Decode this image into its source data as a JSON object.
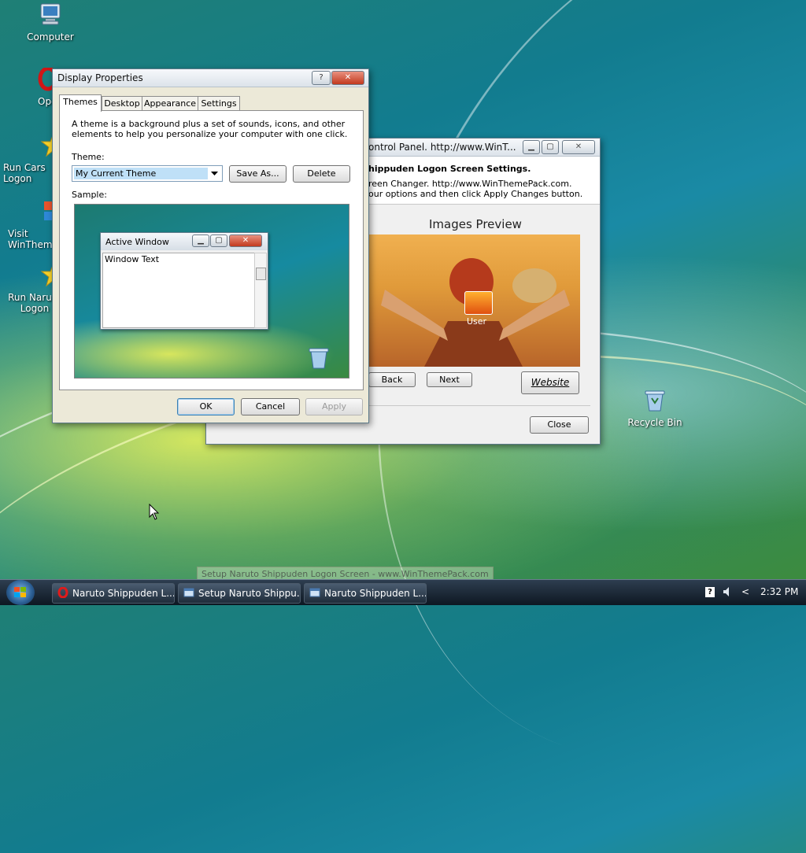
{
  "desktop": {
    "icons": [
      {
        "label": "Computer"
      },
      {
        "label": "Opera"
      },
      {
        "label": "Run Cars Logon"
      },
      {
        "label": "Visit WinThemePack"
      },
      {
        "label": "Run Naruto Logon"
      },
      {
        "label": "Recycle Bin"
      }
    ]
  },
  "display_props": {
    "title": "Display Properties",
    "help_glyph": "?",
    "close_glyph": "✕",
    "tabs": [
      {
        "label": "Themes"
      },
      {
        "label": "Desktop"
      },
      {
        "label": "Appearance"
      },
      {
        "label": "Settings"
      }
    ],
    "description": "A theme is a background plus a set of sounds, icons, and other elements to help you personalize your computer with one click.",
    "theme_label": "Theme:",
    "theme_value": "My Current Theme",
    "save_as": "Save As...",
    "delete": "Delete",
    "sample_label": "Sample:",
    "sample_window_title": "Active Window",
    "sample_window_text": "Window Text",
    "ok": "OK",
    "cancel": "Cancel",
    "apply": "Apply"
  },
  "logon_window": {
    "title": "ontrol Panel. http://www.WinT...",
    "header_title": "hippuden Logon Screen Settings.",
    "header_line1": "reen Changer. http://www.WinThemePack.com.",
    "header_line2": "our options and then click Apply Changes button.",
    "preview_title": "Images Preview",
    "user_label": "User",
    "back": "Back",
    "next": "Next",
    "website": "Website",
    "close": "Close"
  },
  "tooltip": "Setup Naruto Shippuden Logon Screen - www.WinThemePack.com",
  "taskbar": {
    "items": [
      {
        "label": "Naruto Shippuden L..."
      },
      {
        "label": "Setup Naruto Shippu..."
      },
      {
        "label": "Naruto Shippuden L..."
      }
    ],
    "tray_help": "?",
    "tray_arrow": "<",
    "clock": "2:32 PM"
  },
  "colors": {
    "accent": "#3c7fb1",
    "close_red": "#c2391e",
    "taskbar": "#1a2633"
  }
}
